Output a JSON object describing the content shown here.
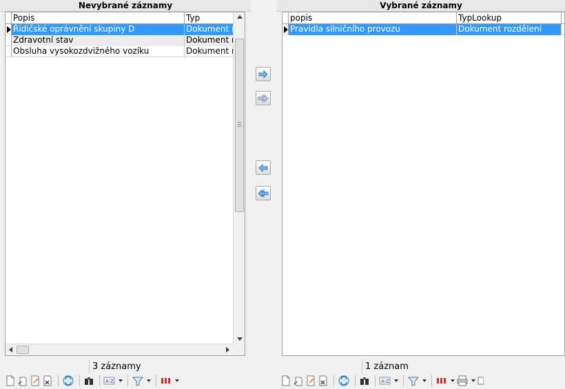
{
  "left": {
    "title": "Nevybrané záznamy",
    "columns": [
      "Popis",
      "Typ"
    ],
    "rows": [
      {
        "popis": "Řidičské oprávnění skupiny D",
        "typ": "Dokument ro",
        "selected": true
      },
      {
        "popis": "Zdravotní stav",
        "typ": "Dokument ro",
        "selected": false
      },
      {
        "popis": "Obsluha vysokozdvižného vozíku",
        "typ": "Dokument ro",
        "selected": false
      }
    ],
    "status": "3 záznamy"
  },
  "right": {
    "title": "Vybrané záznamy",
    "columns": [
      "popis",
      "TypLookup"
    ],
    "rows": [
      {
        "popis": "Pravidla silničního provozu",
        "typ": "Dokument rozdělení",
        "selected": true
      }
    ],
    "status": "1 záznam"
  },
  "transfer": {
    "add_one_icon": "arrow-right-icon",
    "add_all_icon": "double-arrow-right-icon",
    "remove_one_icon": "arrow-left-icon",
    "remove_all_icon": "double-arrow-left-icon"
  },
  "colors": {
    "selection": "#3399ff",
    "accent_arrow": "#3a7fc4"
  }
}
